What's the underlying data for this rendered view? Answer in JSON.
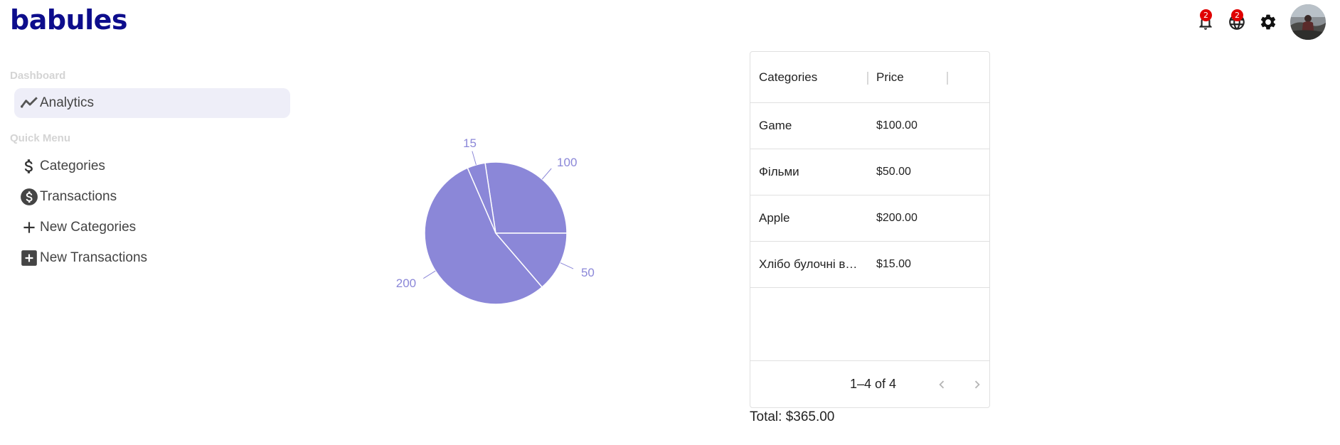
{
  "brand": "babules",
  "topbar": {
    "notifications_count": "2",
    "language_count": "2",
    "icons": [
      "bell-icon",
      "globe-icon",
      "gear-icon",
      "avatar"
    ]
  },
  "sidebar": {
    "section_dashboard": "Dashboard",
    "analytics": "Analytics",
    "section_quick": "Quick Menu",
    "items": [
      {
        "label": "Categories",
        "icon": "dollar-icon"
      },
      {
        "label": "Transactions",
        "icon": "dollar-circle-icon"
      },
      {
        "label": "New Categories",
        "icon": "plus-icon"
      },
      {
        "label": "New Transactions",
        "icon": "plus-box-icon"
      }
    ]
  },
  "chart_data": {
    "type": "pie",
    "values": [
      100,
      15,
      200,
      50
    ],
    "labels": [
      "100",
      "15",
      "200",
      "50"
    ],
    "color": "#8b87d8",
    "edge_color": "#ffffff"
  },
  "grid": {
    "columns": [
      "Categories",
      "Price"
    ],
    "rows": [
      {
        "category": "Game",
        "price": "$100.00"
      },
      {
        "category": "Фільми",
        "price": "$50.00"
      },
      {
        "category": "Apple",
        "price": "$200.00"
      },
      {
        "category": "Хлібо булочні в…",
        "price": "$15.00"
      }
    ],
    "pagination": "1–4 of 4"
  },
  "total": "Total: $365.00",
  "colors": {
    "brand": "#0d0d8c",
    "badge": "#e00000",
    "active_bg": "#eeeef8",
    "pie": "#8b87d8"
  }
}
